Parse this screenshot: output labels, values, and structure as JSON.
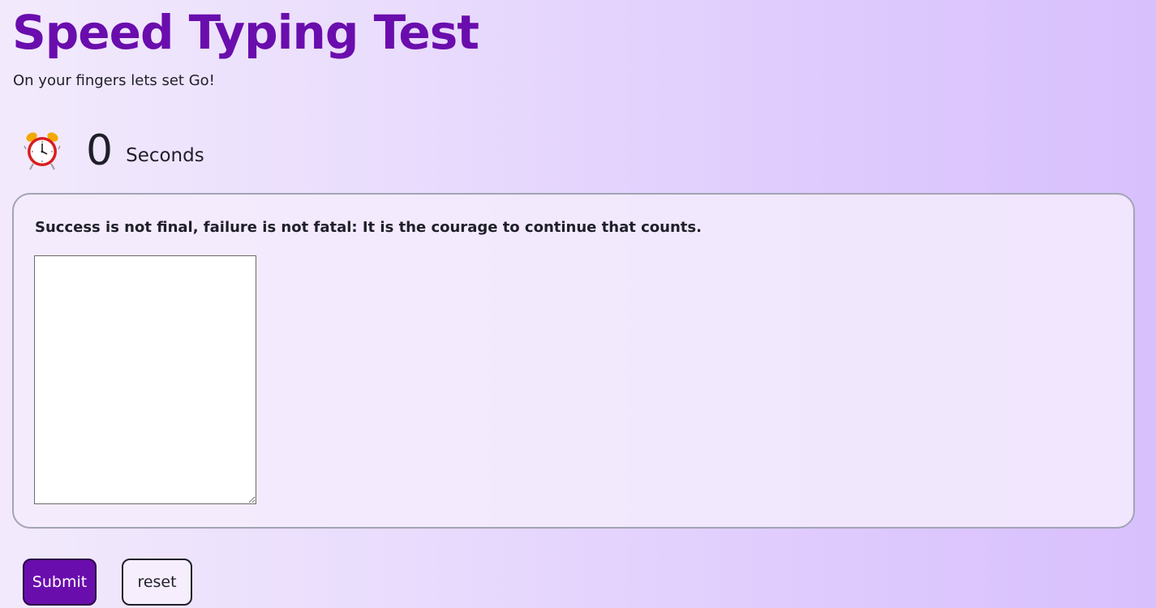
{
  "header": {
    "title": "Speed Typing Test",
    "subtitle": "On your fingers lets set Go!"
  },
  "timer": {
    "icon": "alarm-clock-icon",
    "value": "0",
    "unit": "Seconds"
  },
  "quote_card": {
    "quote": "Success is not final, failure is not fatal: It is the courage to continue that counts.",
    "input_value": "",
    "input_placeholder": ""
  },
  "actions": {
    "submit_label": "Submit",
    "reset_label": "reset"
  },
  "colors": {
    "accent": "#6a0dad",
    "background_start": "#f2eafc",
    "background_end": "#d8c0fd",
    "card_border": "#a3a3b5"
  }
}
